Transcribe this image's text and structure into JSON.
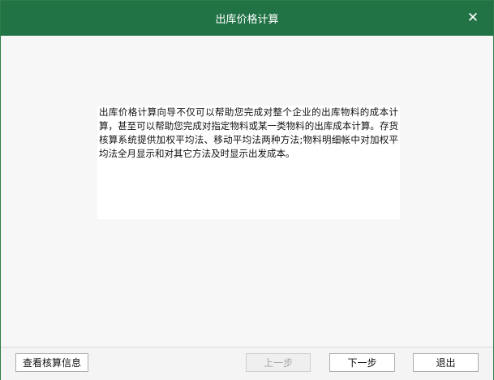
{
  "window": {
    "title": "出库价格计算",
    "close_icon": "close-icon",
    "accent_color": "#217346"
  },
  "content": {
    "description": "出库价格计算向导不仅可以帮助您完成对整个企业的出库物料的成本计算，甚至可以帮助您完成对指定物料或某一类物料的出库成本计算。存货核算系统提供加权平均法、移动平均法两种方法;物料明细帐中对加权平均法全月显示和对其它方法及时显示出发成本。"
  },
  "footer": {
    "info_label": "查看核算信息",
    "prev_label": "上一步",
    "next_label": "下一步",
    "exit_label": "退出"
  }
}
